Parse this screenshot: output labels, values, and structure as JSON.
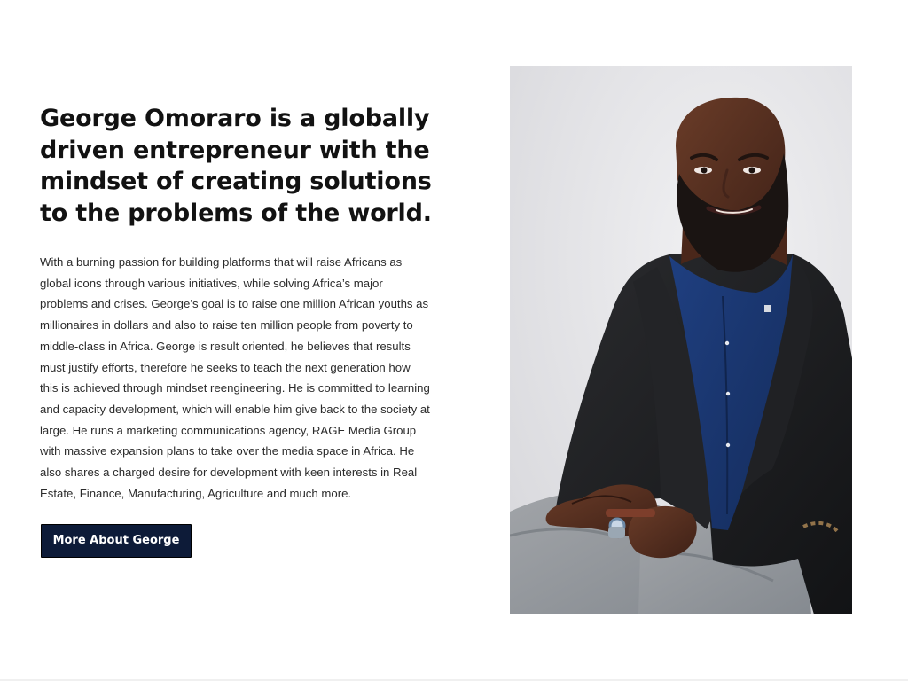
{
  "about": {
    "headline": "George Omoraro is a globally driven entrepreneur with the mindset of creating solutions to the problems of the world.",
    "bio": "With a burning passion for building platforms that will raise Africans as global icons through various initiatives, while solving Africa’s major problems and crises. George’s goal is to raise one million African youths as millionaires in dollars and also to raise ten million people from poverty to middle-class in Africa. George is result oriented, he believes that results must justify efforts, therefore he seeks to teach the next generation how this is achieved through mindset reengineering. He is committed to learning and capacity development, which will enable him give back to the society at large. He runs a marketing communications agency, RAGE Media Group with massive expansion plans to take over the media space in Africa. He also shares a charged desire for development with keen interests in Real Estate, Finance, Manufacturing, Agriculture and much more.",
    "button_label": "More About George"
  },
  "colors": {
    "button_background": "#0d1b38",
    "button_text": "#ffffff",
    "headline": "#121212",
    "body_text": "#2b2b2b",
    "photo_background": "#e6e6e9"
  }
}
